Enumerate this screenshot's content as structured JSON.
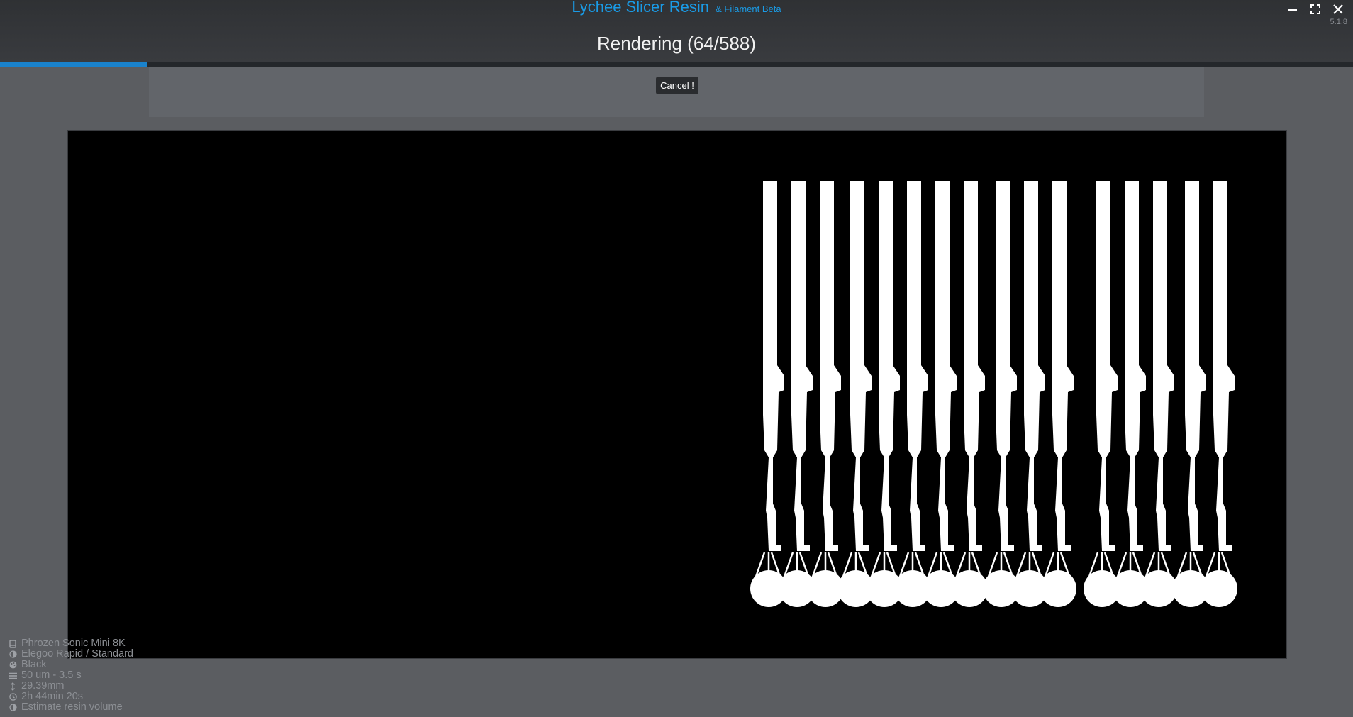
{
  "app": {
    "title": "Lychee Slicer Resin",
    "subtitle": "& Filament Beta",
    "version": "5.1.8"
  },
  "window_controls": {
    "minimize_icon": "minimize-icon",
    "maximize_icon": "maximize-icon",
    "close_icon": "close-icon"
  },
  "render": {
    "status": "Rendering (64/588)",
    "current": 64,
    "total": 588,
    "progress": 0.109
  },
  "cancel": {
    "label": "Cancel !"
  },
  "colors": {
    "accent": "#1a9be6",
    "progress": "#1a82cc",
    "preview_background": "#000000",
    "layer_fill": "#ffffff"
  },
  "preview": {
    "description_icons": "sliced layer of 16 upright parts with supports",
    "part_count": 16
  },
  "info": {
    "printer": "Phrozen Sonic Mini 8K",
    "resin": "Elegoo Rapid / Standard",
    "color": "Black",
    "layer": "50 um - 3.5 s",
    "height": "29.39mm",
    "time": "2h 44min 20s",
    "estimate_link": "Estimate resin volume"
  }
}
